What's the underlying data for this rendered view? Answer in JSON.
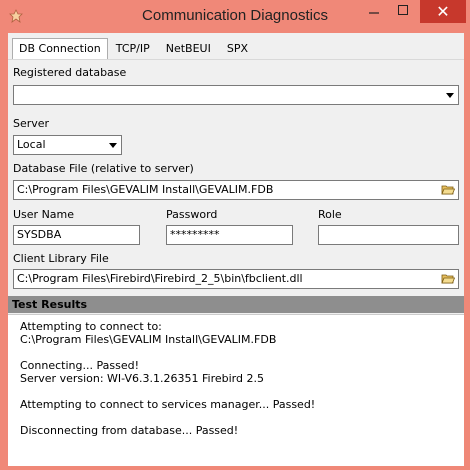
{
  "window": {
    "title": "Communication Diagnostics",
    "close_symbol": "✕"
  },
  "tabs": [
    {
      "label": "DB Connection",
      "active": true
    },
    {
      "label": "TCP/IP",
      "active": false
    },
    {
      "label": "NetBEUI",
      "active": false
    },
    {
      "label": "SPX",
      "active": false
    }
  ],
  "db_connection": {
    "registered_database_label": "Registered database",
    "registered_database_value": "",
    "server_label": "Server",
    "server_value": "Local",
    "database_file_label": "Database File (relative to server)",
    "database_file_value": "C:\\Program Files\\GEVALIM Install\\GEVALIM.FDB",
    "user_name_label": "User Name",
    "user_name_value": "SYSDBA",
    "password_label": "Password",
    "password_value": "*********",
    "role_label": "Role",
    "role_value": "",
    "client_library_label": "Client Library File",
    "client_library_value": "C:\\Program Files\\Firebird\\Firebird_2_5\\bin\\fbclient.dll"
  },
  "test_results": {
    "header": "Test Results",
    "lines": [
      "Attempting to connect to:",
      "C:\\Program Files\\GEVALIM Install\\GEVALIM.FDB",
      "",
      "Connecting... Passed!",
      "Server version: WI-V6.3.1.26351 Firebird 2.5",
      "",
      "Attempting to connect to services manager... Passed!",
      "",
      "Disconnecting from database... Passed!"
    ]
  },
  "icons": {
    "app": "app-icon",
    "minimize": "minimize-icon",
    "maximize": "maximize-icon",
    "close": "close-icon",
    "dropdown": "chevron-down-icon",
    "browse": "folder-open-icon"
  },
  "colors": {
    "titlebar": "#f08878",
    "close_button": "#c7382c",
    "results_header": "#8e8e8e"
  }
}
